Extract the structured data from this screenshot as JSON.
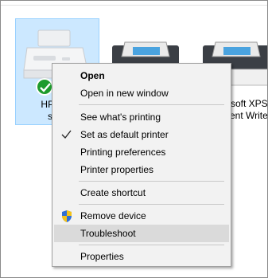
{
  "devices": [
    {
      "id": "hp",
      "name_line1": "HP Des",
      "name_line2": "se",
      "selected": true,
      "default": true
    },
    {
      "id": "printer2",
      "name_line1": "",
      "name_line2": ""
    },
    {
      "id": "xps",
      "name_line1": "soft XPS",
      "name_line2": "ent Write"
    }
  ],
  "context_menu": {
    "items": [
      {
        "label": "Open",
        "bold": true
      },
      {
        "label": "Open in new window"
      },
      {
        "label": "See what's printing"
      },
      {
        "label": "Set as default printer",
        "checked": true
      },
      {
        "label": "Printing preferences"
      },
      {
        "label": "Printer properties"
      },
      {
        "label": "Create shortcut"
      },
      {
        "label": "Remove device",
        "icon": "uac-shield-icon"
      },
      {
        "label": "Troubleshoot",
        "highlighted": true
      },
      {
        "label": "Properties"
      }
    ]
  },
  "colors": {
    "selection": "#cce8ff",
    "menu_bg": "#f2f2f2",
    "menu_highlight": "#dadada",
    "check_badge": "#1e9b2d"
  }
}
